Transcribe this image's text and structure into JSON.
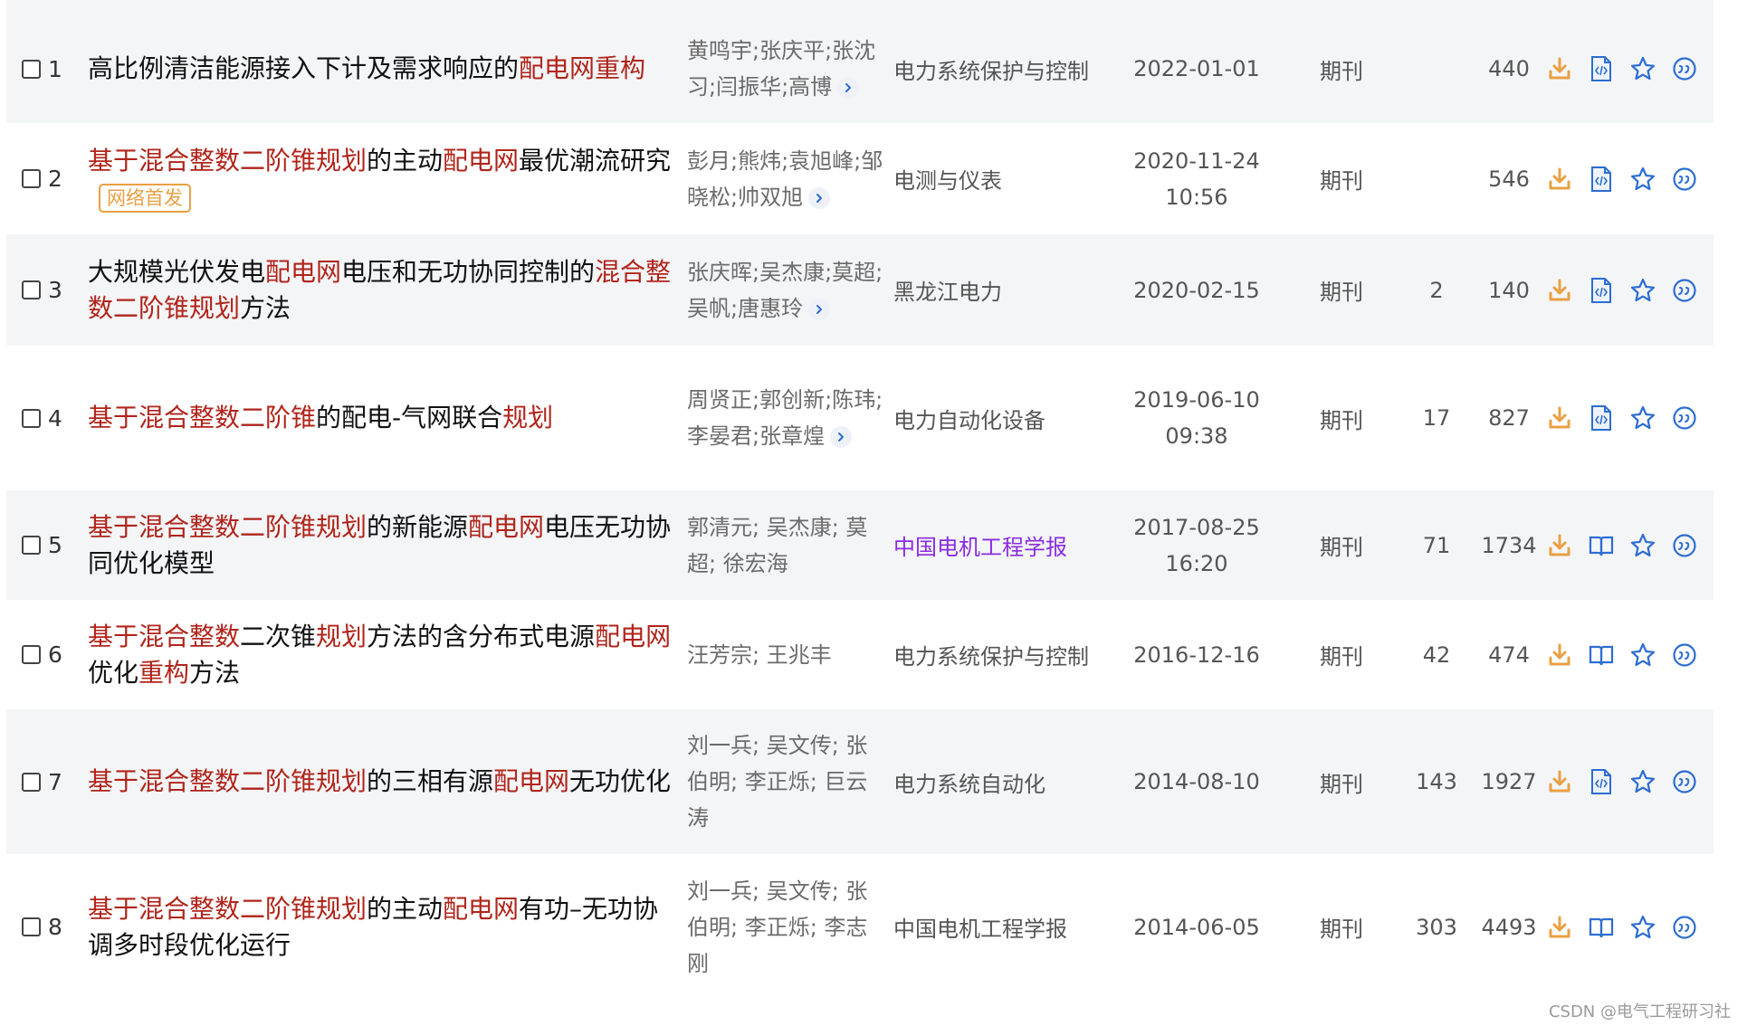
{
  "rows": [
    {
      "index": "1",
      "shaded": true,
      "height": 120,
      "title": [
        {
          "t": "高比例清洁能源接入下计及需求响应的"
        },
        {
          "t": "配电网重构",
          "hl": true
        }
      ],
      "authors": "黄鸣宇;张庆平;张沈习;闫振华;高博",
      "authors_more": true,
      "source": "电力系统保护与控制",
      "source_purple": false,
      "date": "2022-01-01",
      "type": "期刊",
      "cited": "",
      "downloads": "440",
      "reader": "html"
    },
    {
      "index": "2",
      "shaded": false,
      "height": 123,
      "title": [
        {
          "t": "基于混合整数二阶锥规划",
          "hl": true
        },
        {
          "t": "的主动"
        },
        {
          "t": "配电网",
          "hl": true
        },
        {
          "t": "最优潮流研究"
        }
      ],
      "tag": "网络首发",
      "authors": "彭月;熊炜;袁旭峰;邹晓松;帅双旭",
      "authors_more": true,
      "source": "电测与仪表",
      "source_purple": false,
      "date": "2020-11-24 10:56",
      "type": "期刊",
      "cited": "",
      "downloads": "546",
      "reader": "html"
    },
    {
      "index": "3",
      "shaded": true,
      "height": 123,
      "title": [
        {
          "t": "大规模光伏发电"
        },
        {
          "t": "配电网",
          "hl": true
        },
        {
          "t": "电压和无功协同控制的"
        },
        {
          "t": "混合整数二阶锥规划",
          "hl": true
        },
        {
          "t": "方法"
        }
      ],
      "authors": "张庆晖;吴杰康;莫超;吴帆;唐惠玲",
      "authors_more": true,
      "source": "黑龙江电力",
      "source_purple": false,
      "date": "2020-02-15",
      "type": "期刊",
      "cited": "2",
      "downloads": "140",
      "reader": "html"
    },
    {
      "index": "4",
      "shaded": false,
      "height": 160,
      "title": [
        {
          "t": "基于混合整数二阶锥",
          "hl": true
        },
        {
          "t": "的配电-气网联合"
        },
        {
          "t": "规划",
          "hl": true
        }
      ],
      "authors": "周贤正;郭创新;陈玮;李晏君;张章煌",
      "authors_more": true,
      "source": "电力自动化设备",
      "source_purple": false,
      "date": "2019-06-10 09:38",
      "type": "期刊",
      "cited": "17",
      "downloads": "827",
      "reader": "html"
    },
    {
      "index": "5",
      "shaded": true,
      "height": 121,
      "title": [
        {
          "t": "基于混合整数二阶锥规划",
          "hl": true
        },
        {
          "t": "的新能源"
        },
        {
          "t": "配电网",
          "hl": true
        },
        {
          "t": "电压无功协同优化模型"
        }
      ],
      "authors": "郭清元; 吴杰康; 莫超; 徐宏海",
      "authors_more": false,
      "source": "中国电机工程学报",
      "source_purple": true,
      "date": "2017-08-25 16:20",
      "type": "期刊",
      "cited": "71",
      "downloads": "1734",
      "reader": "book"
    },
    {
      "index": "6",
      "shaded": false,
      "height": 121,
      "title": [
        {
          "t": "基于混合整数",
          "hl": true
        },
        {
          "t": "二次锥"
        },
        {
          "t": "规划",
          "hl": true
        },
        {
          "t": "方法的含分布式电源"
        },
        {
          "t": "配电网",
          "hl": true
        },
        {
          "t": "优化"
        },
        {
          "t": "重构",
          "hl": true
        },
        {
          "t": "方法"
        }
      ],
      "authors": "汪芳宗; 王兆丰",
      "authors_more": false,
      "source": "电力系统保护与控制",
      "source_purple": false,
      "date": "2016-12-16",
      "type": "期刊",
      "cited": "42",
      "downloads": "474",
      "reader": "book"
    },
    {
      "index": "7",
      "shaded": true,
      "height": 160,
      "title": [
        {
          "t": "基于混合整数二阶锥规划",
          "hl": true
        },
        {
          "t": "的三相有源"
        },
        {
          "t": "配电网",
          "hl": true
        },
        {
          "t": "无功优化"
        }
      ],
      "authors": "刘一兵; 吴文传; 张伯明; 李正烁; 巨云涛",
      "authors_more": false,
      "source": "电力系统自动化",
      "source_purple": false,
      "date": "2014-08-10",
      "type": "期刊",
      "cited": "143",
      "downloads": "1927",
      "reader": "html"
    },
    {
      "index": "8",
      "shaded": false,
      "height": 161,
      "title": [
        {
          "t": "基于混合整数二阶锥规划",
          "hl": true
        },
        {
          "t": "的主动"
        },
        {
          "t": "配电网",
          "hl": true
        },
        {
          "t": "有功–无功协调多时段优化运行"
        }
      ],
      "authors": "刘一兵; 吴文传; 张伯明; 李正烁; 李志刚",
      "authors_more": false,
      "source": "中国电机工程学报",
      "source_purple": false,
      "date": "2014-06-05",
      "type": "期刊",
      "cited": "303",
      "downloads": "4493",
      "reader": "book"
    }
  ],
  "icons": {
    "download": "download-icon",
    "html_reader": "html-reader-icon",
    "book_reader": "book-reader-icon",
    "favorite": "star-icon",
    "quote": "quote-icon",
    "more": "chevron-right-icon"
  },
  "colors": {
    "highlight": "#b0241a",
    "download": "#e9a043",
    "action": "#2c6dd2",
    "tag": "#e9a043",
    "purple_source": "#8a2be2"
  },
  "watermark": "CSDN @电气工程研习社"
}
